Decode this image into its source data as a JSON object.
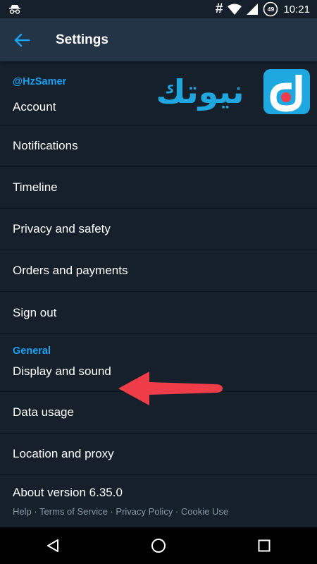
{
  "status_bar": {
    "left_icon": "incognito-icon",
    "hash": "#",
    "battery": "49",
    "time": "10:21"
  },
  "toolbar": {
    "back_icon": "back-arrow-icon",
    "title": "Settings"
  },
  "account_section": {
    "header": "@HzSamer",
    "items": [
      {
        "label": "Account"
      },
      {
        "label": "Notifications"
      },
      {
        "label": "Timeline"
      },
      {
        "label": "Privacy and safety"
      },
      {
        "label": "Orders and payments"
      },
      {
        "label": "Sign out"
      }
    ]
  },
  "general_section": {
    "header": "General",
    "items": [
      {
        "label": "Display and sound"
      },
      {
        "label": "Data usage"
      },
      {
        "label": "Location and proxy"
      }
    ]
  },
  "about": {
    "label": "About version 6.35.0",
    "sub": "Help · Terms of Service · Privacy Policy · Cookie Use"
  },
  "overlay": {
    "logo_text": "نيوتك",
    "arrow_color": "#ee3d48",
    "logo_color": "#1fa8e0"
  },
  "colors": {
    "background": "#15202b",
    "toolbar": "#243447",
    "accent": "#1da1f2"
  }
}
